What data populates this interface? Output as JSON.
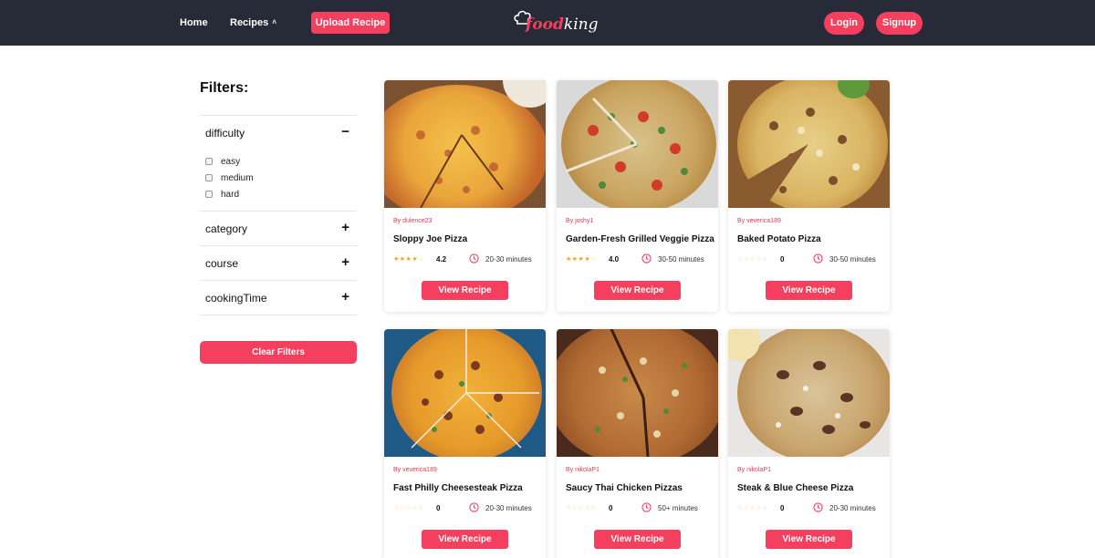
{
  "nav": {
    "home": "Home",
    "recipes": "Recipes",
    "upload": "Upload Recipe",
    "logo_part1": "food",
    "logo_part2": "king",
    "login": "Login",
    "signup": "Signup"
  },
  "filters": {
    "title": "Filters:",
    "difficulty": {
      "label": "difficulty",
      "toggle": "−",
      "options": [
        "easy",
        "medium",
        "hard"
      ]
    },
    "category": {
      "label": "category",
      "toggle": "+"
    },
    "course": {
      "label": "course",
      "toggle": "+"
    },
    "cookingTime": {
      "label": "cookingTime",
      "toggle": "+"
    },
    "clear": "Clear Filters"
  },
  "colors": {
    "navbar": "#272b38",
    "accent": "#f43f5e",
    "star": "#f6a21e"
  },
  "cards": [
    {
      "author": "By dulence23",
      "title": "Sloppy Joe Pizza",
      "stars": 4,
      "rating": "4.2",
      "time": "20-30 minutes",
      "button": "View Recipe"
    },
    {
      "author": "By joshy1",
      "title": "Garden-Fresh Grilled Veggie Pizza",
      "stars": 4,
      "rating": "4.0",
      "time": "30-50 minutes",
      "button": "View Recipe"
    },
    {
      "author": "By veverica189",
      "title": "Baked Potato Pizza",
      "stars": 0,
      "rating": "0",
      "time": "30-50 minutes",
      "button": "View Recipe"
    },
    {
      "author": "By veverica189",
      "title": "Fast Philly Cheesesteak Pizza",
      "stars": 0,
      "rating": "0",
      "time": "20-30 minutes",
      "button": "View Recipe"
    },
    {
      "author": "By nikolaP1",
      "title": "Saucy Thai Chicken Pizzas",
      "stars": 0,
      "rating": "0",
      "time": "50+ minutes",
      "button": "View Recipe"
    },
    {
      "author": "By nikolaP1",
      "title": "Steak & Blue Cheese Pizza",
      "stars": 0,
      "rating": "0",
      "time": "20-30 minutes",
      "button": "View Recipe"
    }
  ]
}
